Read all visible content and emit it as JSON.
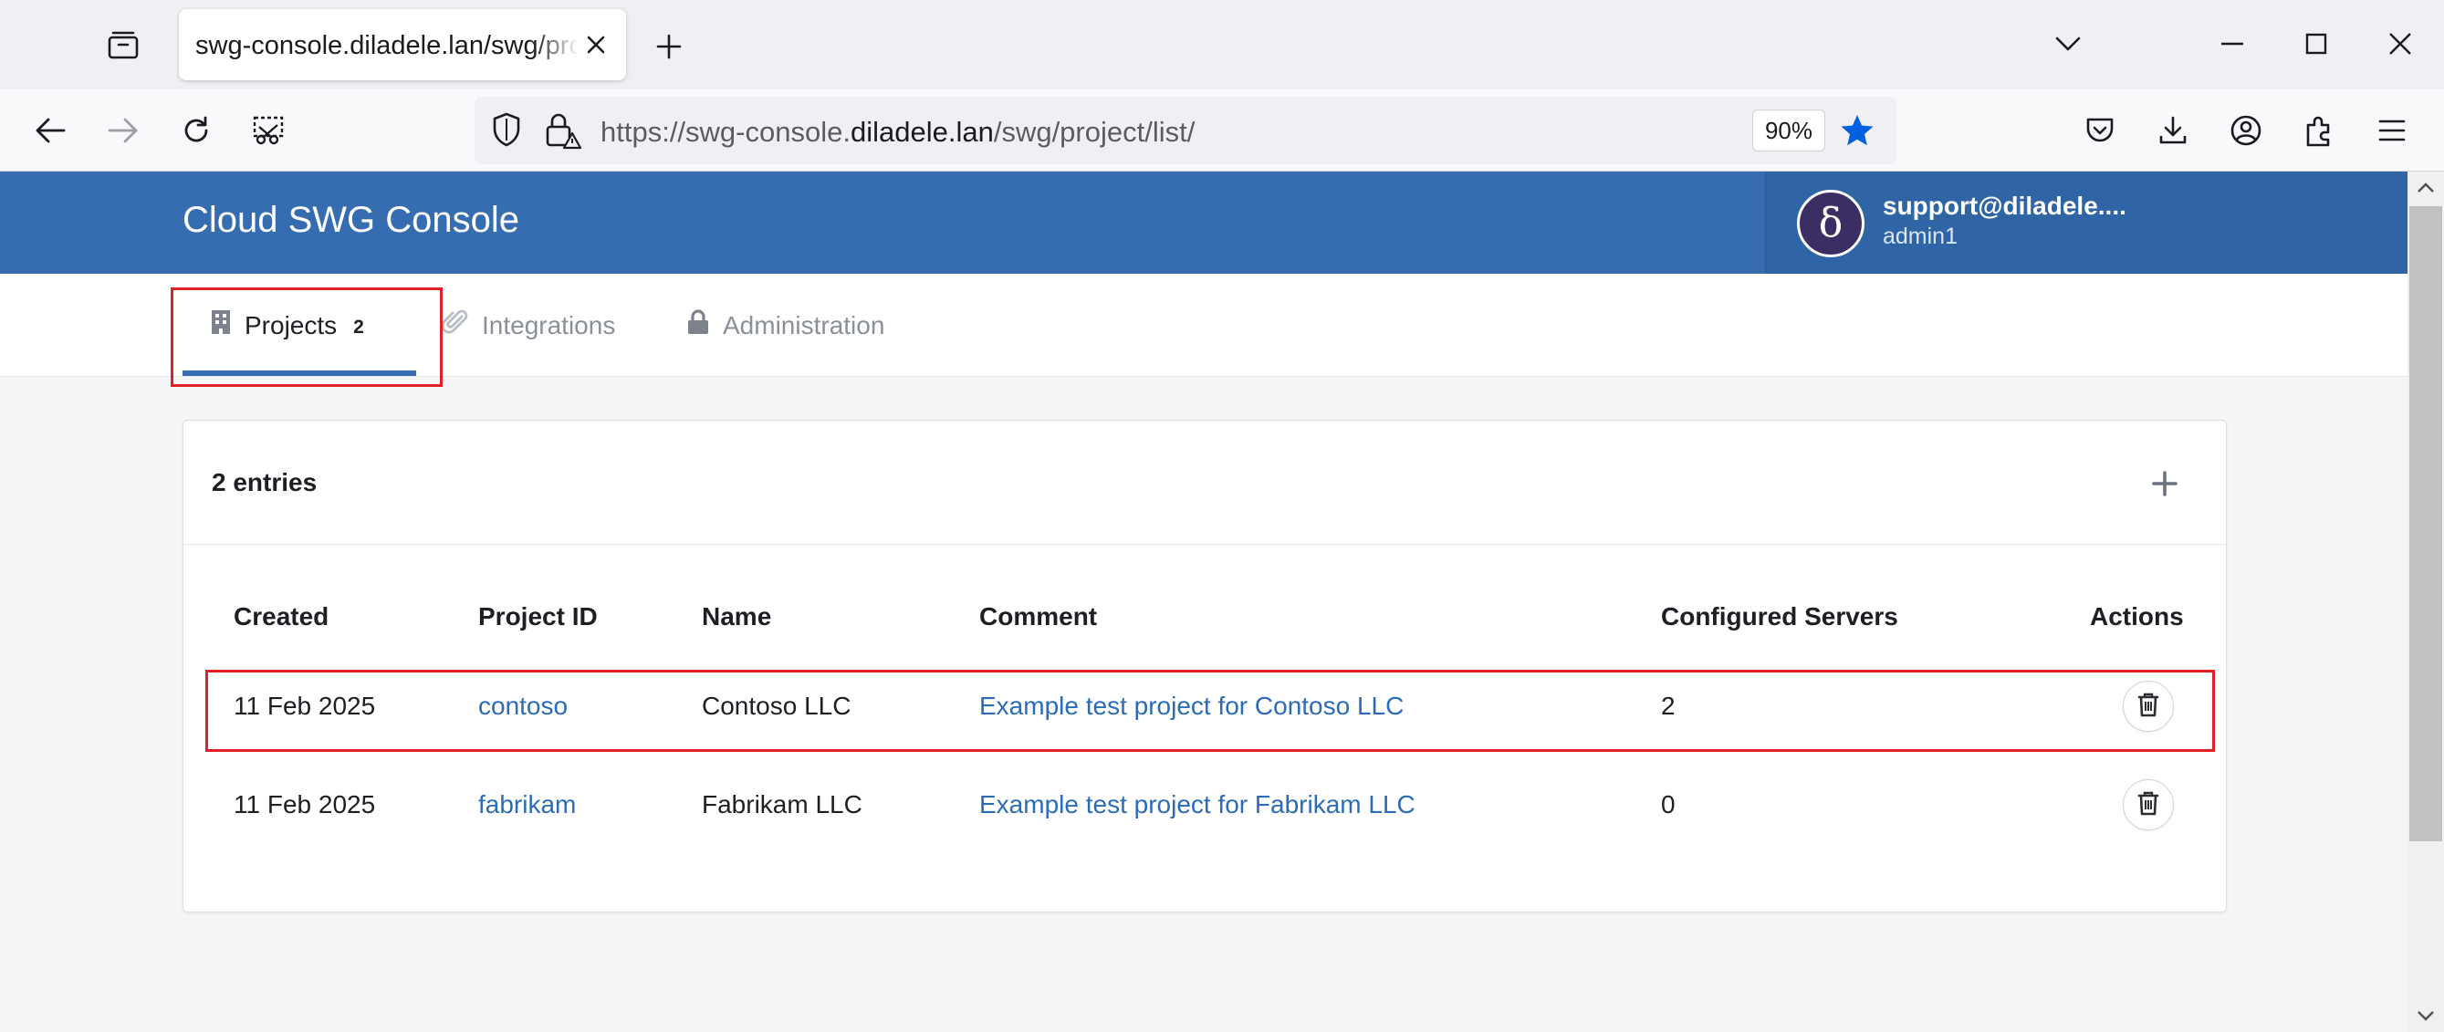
{
  "browser": {
    "tab_title": "swg-console.diladele.lan/swg/project/list/",
    "url_prefix": "https://swg-console.",
    "url_domain": "diladele.lan",
    "url_path": "/swg/project/list/",
    "zoom": "90%"
  },
  "app": {
    "title": "Cloud SWG Console",
    "user": {
      "email": "support@diladele....",
      "role": "admin1",
      "avatar_glyph": "δ"
    }
  },
  "nav_tabs": [
    {
      "label": "Projects",
      "count": "2",
      "icon": "building-icon"
    },
    {
      "label": "Integrations",
      "icon": "paperclip-icon"
    },
    {
      "label": "Administration",
      "icon": "lock-icon"
    }
  ],
  "list": {
    "entries_label": "2 entries",
    "columns": [
      "Created",
      "Project ID",
      "Name",
      "Comment",
      "Configured Servers",
      "Actions"
    ],
    "rows": [
      {
        "created": "11 Feb 2025",
        "project_id": "contoso",
        "name": "Contoso LLC",
        "comment": "Example test project for Contoso LLC",
        "servers": "2"
      },
      {
        "created": "11 Feb 2025",
        "project_id": "fabrikam",
        "name": "Fabrikam LLC",
        "comment": "Example test project for Fabrikam LLC",
        "servers": "0"
      }
    ]
  },
  "colors": {
    "header": "#356db0",
    "link": "#2b6cb8",
    "highlight": "#e32026",
    "star": "#0060df"
  }
}
